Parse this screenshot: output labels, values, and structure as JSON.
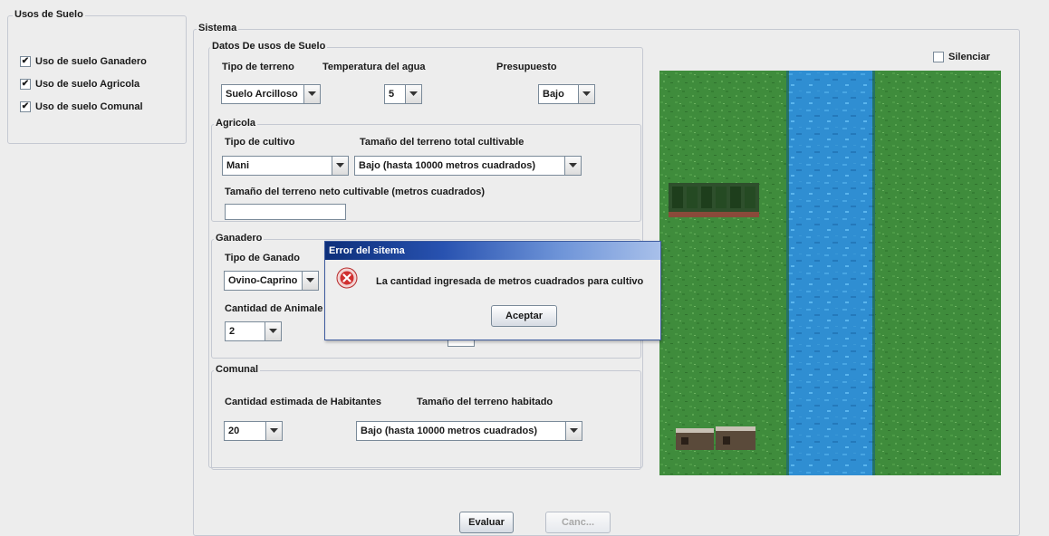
{
  "left_panel": {
    "title": "Usos de Suelo",
    "items": [
      {
        "label": "Uso de suelo Ganadero",
        "checked": true
      },
      {
        "label": "Uso de suelo Agricola",
        "checked": true
      },
      {
        "label": "Uso de suelo Comunal",
        "checked": true
      }
    ]
  },
  "sistema": {
    "title": "Sistema",
    "silenciar": {
      "label": "Silenciar",
      "checked": false
    },
    "datos": {
      "title": "Datos De usos de Suelo",
      "tipo_terreno": {
        "label": "Tipo de terreno",
        "value": "Suelo Arcilloso"
      },
      "temperatura": {
        "label": "Temperatura del agua",
        "value": "5"
      },
      "presupuesto": {
        "label": "Presupuesto",
        "value": "Bajo"
      }
    },
    "agricola": {
      "title": "Agricola",
      "tipo_cultivo": {
        "label": "Tipo de cultivo",
        "value": "Mani"
      },
      "tamano_total": {
        "label": "Tamaño del terreno total cultivable",
        "value": "Bajo (hasta 10000 metros cuadrados)"
      },
      "tamano_neto": {
        "label": "Tamaño del terreno neto cultivable (metros cuadrados)",
        "value": ""
      }
    },
    "ganadero": {
      "title": "Ganadero",
      "tipo_ganado": {
        "label": "Tipo de Ganado",
        "value": "Ovino-Caprino"
      },
      "cantidad_animales": {
        "label": "Cantidad de Animale",
        "value": "2"
      }
    },
    "comunal": {
      "title": "Comunal",
      "habitantes": {
        "label": "Cantidad estimada de Habitantes",
        "value": "20"
      },
      "tamano_habitado": {
        "label": "Tamaño del terreno habitado",
        "value": "Bajo (hasta 10000 metros cuadrados)"
      }
    },
    "buttons": {
      "evaluar": "Evaluar",
      "cancelar": "Canc..."
    }
  },
  "dialog": {
    "title": "Error del sitema",
    "message": "La cantidad ingresada de metros cuadrados para cultivo",
    "accept": "Aceptar",
    "icon": "error-icon"
  },
  "colors": {
    "grass": "#3c8a3a",
    "river": "#2f8fd0",
    "dialog_title": "#0d2f7a",
    "error_icon": "#d03030"
  }
}
